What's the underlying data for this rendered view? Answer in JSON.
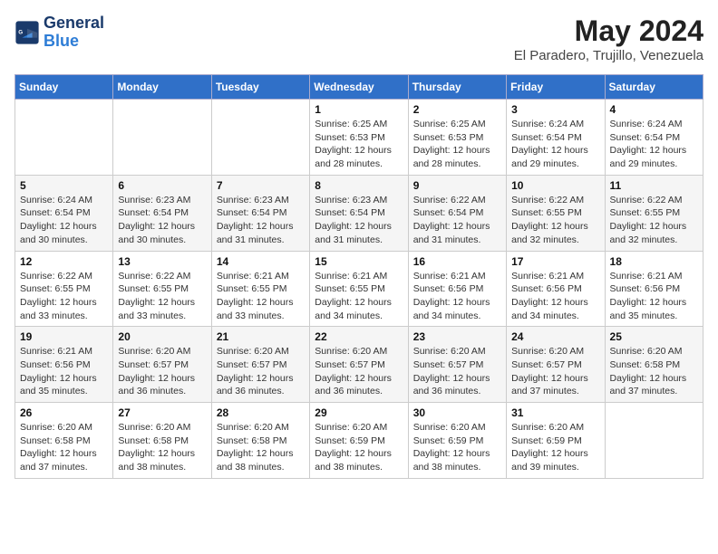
{
  "header": {
    "logo_line1": "General",
    "logo_line2": "Blue",
    "month_title": "May 2024",
    "location": "El Paradero, Trujillo, Venezuela"
  },
  "days_of_week": [
    "Sunday",
    "Monday",
    "Tuesday",
    "Wednesday",
    "Thursday",
    "Friday",
    "Saturday"
  ],
  "weeks": [
    [
      {
        "day": "",
        "info": ""
      },
      {
        "day": "",
        "info": ""
      },
      {
        "day": "",
        "info": ""
      },
      {
        "day": "1",
        "info": "Sunrise: 6:25 AM\nSunset: 6:53 PM\nDaylight: 12 hours\nand 28 minutes."
      },
      {
        "day": "2",
        "info": "Sunrise: 6:25 AM\nSunset: 6:53 PM\nDaylight: 12 hours\nand 28 minutes."
      },
      {
        "day": "3",
        "info": "Sunrise: 6:24 AM\nSunset: 6:54 PM\nDaylight: 12 hours\nand 29 minutes."
      },
      {
        "day": "4",
        "info": "Sunrise: 6:24 AM\nSunset: 6:54 PM\nDaylight: 12 hours\nand 29 minutes."
      }
    ],
    [
      {
        "day": "5",
        "info": "Sunrise: 6:24 AM\nSunset: 6:54 PM\nDaylight: 12 hours\nand 30 minutes."
      },
      {
        "day": "6",
        "info": "Sunrise: 6:23 AM\nSunset: 6:54 PM\nDaylight: 12 hours\nand 30 minutes."
      },
      {
        "day": "7",
        "info": "Sunrise: 6:23 AM\nSunset: 6:54 PM\nDaylight: 12 hours\nand 31 minutes."
      },
      {
        "day": "8",
        "info": "Sunrise: 6:23 AM\nSunset: 6:54 PM\nDaylight: 12 hours\nand 31 minutes."
      },
      {
        "day": "9",
        "info": "Sunrise: 6:22 AM\nSunset: 6:54 PM\nDaylight: 12 hours\nand 31 minutes."
      },
      {
        "day": "10",
        "info": "Sunrise: 6:22 AM\nSunset: 6:55 PM\nDaylight: 12 hours\nand 32 minutes."
      },
      {
        "day": "11",
        "info": "Sunrise: 6:22 AM\nSunset: 6:55 PM\nDaylight: 12 hours\nand 32 minutes."
      }
    ],
    [
      {
        "day": "12",
        "info": "Sunrise: 6:22 AM\nSunset: 6:55 PM\nDaylight: 12 hours\nand 33 minutes."
      },
      {
        "day": "13",
        "info": "Sunrise: 6:22 AM\nSunset: 6:55 PM\nDaylight: 12 hours\nand 33 minutes."
      },
      {
        "day": "14",
        "info": "Sunrise: 6:21 AM\nSunset: 6:55 PM\nDaylight: 12 hours\nand 33 minutes."
      },
      {
        "day": "15",
        "info": "Sunrise: 6:21 AM\nSunset: 6:55 PM\nDaylight: 12 hours\nand 34 minutes."
      },
      {
        "day": "16",
        "info": "Sunrise: 6:21 AM\nSunset: 6:56 PM\nDaylight: 12 hours\nand 34 minutes."
      },
      {
        "day": "17",
        "info": "Sunrise: 6:21 AM\nSunset: 6:56 PM\nDaylight: 12 hours\nand 34 minutes."
      },
      {
        "day": "18",
        "info": "Sunrise: 6:21 AM\nSunset: 6:56 PM\nDaylight: 12 hours\nand 35 minutes."
      }
    ],
    [
      {
        "day": "19",
        "info": "Sunrise: 6:21 AM\nSunset: 6:56 PM\nDaylight: 12 hours\nand 35 minutes."
      },
      {
        "day": "20",
        "info": "Sunrise: 6:20 AM\nSunset: 6:57 PM\nDaylight: 12 hours\nand 36 minutes."
      },
      {
        "day": "21",
        "info": "Sunrise: 6:20 AM\nSunset: 6:57 PM\nDaylight: 12 hours\nand 36 minutes."
      },
      {
        "day": "22",
        "info": "Sunrise: 6:20 AM\nSunset: 6:57 PM\nDaylight: 12 hours\nand 36 minutes."
      },
      {
        "day": "23",
        "info": "Sunrise: 6:20 AM\nSunset: 6:57 PM\nDaylight: 12 hours\nand 36 minutes."
      },
      {
        "day": "24",
        "info": "Sunrise: 6:20 AM\nSunset: 6:57 PM\nDaylight: 12 hours\nand 37 minutes."
      },
      {
        "day": "25",
        "info": "Sunrise: 6:20 AM\nSunset: 6:58 PM\nDaylight: 12 hours\nand 37 minutes."
      }
    ],
    [
      {
        "day": "26",
        "info": "Sunrise: 6:20 AM\nSunset: 6:58 PM\nDaylight: 12 hours\nand 37 minutes."
      },
      {
        "day": "27",
        "info": "Sunrise: 6:20 AM\nSunset: 6:58 PM\nDaylight: 12 hours\nand 38 minutes."
      },
      {
        "day": "28",
        "info": "Sunrise: 6:20 AM\nSunset: 6:58 PM\nDaylight: 12 hours\nand 38 minutes."
      },
      {
        "day": "29",
        "info": "Sunrise: 6:20 AM\nSunset: 6:59 PM\nDaylight: 12 hours\nand 38 minutes."
      },
      {
        "day": "30",
        "info": "Sunrise: 6:20 AM\nSunset: 6:59 PM\nDaylight: 12 hours\nand 38 minutes."
      },
      {
        "day": "31",
        "info": "Sunrise: 6:20 AM\nSunset: 6:59 PM\nDaylight: 12 hours\nand 39 minutes."
      },
      {
        "day": "",
        "info": ""
      }
    ]
  ]
}
